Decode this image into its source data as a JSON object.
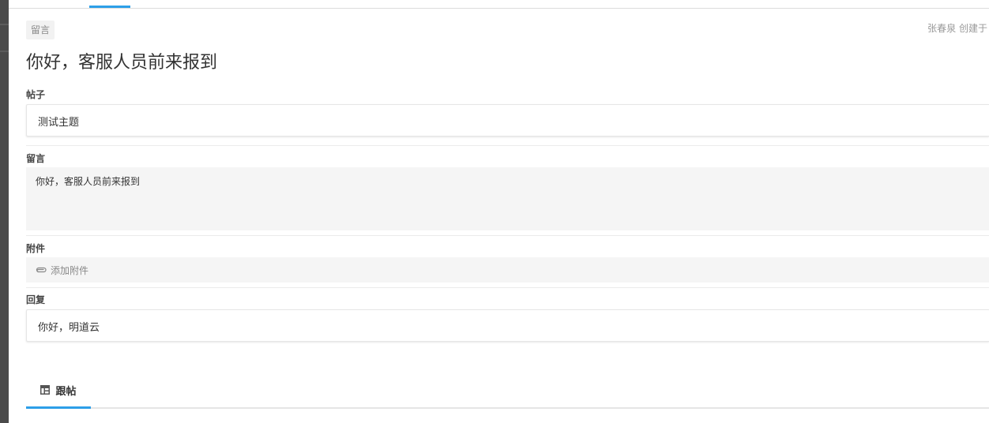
{
  "record": {
    "type_badge": "留言",
    "meta": "张春泉 创建于",
    "title": "你好，客服人员前来报到"
  },
  "fields": {
    "post": {
      "label": "帖子",
      "value": "测试主题"
    },
    "message": {
      "label": "留言",
      "value": "你好，客服人员前来报到"
    },
    "attachment": {
      "label": "附件",
      "action_label": "添加附件"
    },
    "reply": {
      "label": "回复",
      "value": "你好，明道云"
    }
  },
  "tabs": [
    {
      "label": "跟帖",
      "icon": "table-icon",
      "active": true
    }
  ],
  "colors": {
    "accent": "#2d9fe8",
    "sidebar": "#4a4a4a"
  }
}
